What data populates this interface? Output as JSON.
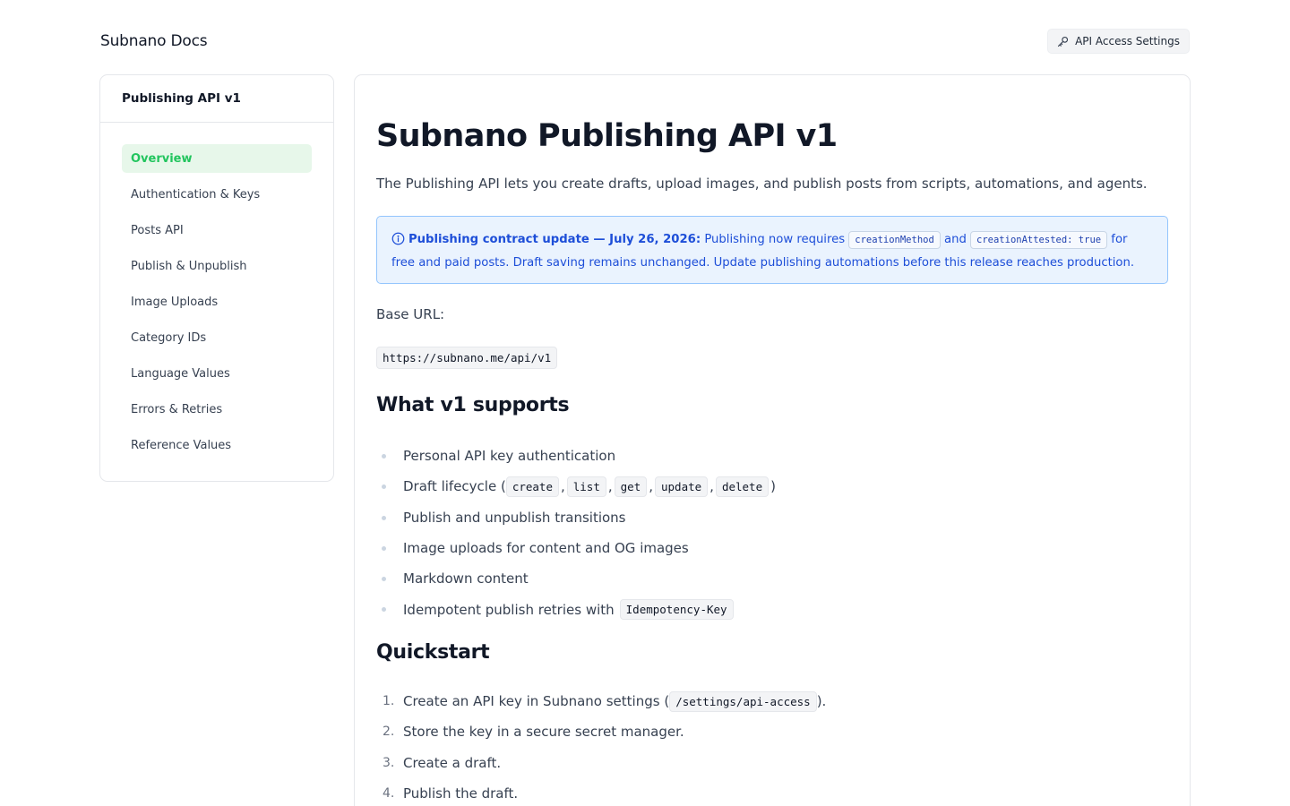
{
  "header": {
    "brand": "Subnano Docs",
    "api_button_label": "API Access Settings",
    "api_button_icon": "key-icon"
  },
  "sidebar": {
    "title": "Publishing API v1",
    "items": [
      {
        "label": "Overview",
        "active": true
      },
      {
        "label": "Authentication & Keys"
      },
      {
        "label": "Posts API"
      },
      {
        "label": "Publish & Unpublish"
      },
      {
        "label": "Image Uploads"
      },
      {
        "label": "Category IDs"
      },
      {
        "label": "Language Values"
      },
      {
        "label": "Errors & Retries"
      },
      {
        "label": "Reference Values"
      }
    ],
    "active_color": "#22c55e"
  },
  "main": {
    "title": "Subnano Publishing API v1",
    "intro": "The Publishing API lets you create drafts, upload images, and publish posts from scripts, automations, and agents.",
    "callout": {
      "icon": "info-icon",
      "heading": "Publishing contract update — July 26, 2026:",
      "text_1": "Publishing now requires",
      "code_1": "creationMethod",
      "and": "and",
      "code_2": "creationAttested: true",
      "text_2": "for free and paid posts. Draft saving remains unchanged. Update publishing automations before this release reaches production.",
      "accent": "#1d4ed8"
    },
    "base_url_label": "Base URL:",
    "base_url": "https://subnano.me/api/v1",
    "supports_heading": "What v1 supports",
    "supports": {
      "item_1": "Personal API key authentication",
      "item_2_prefix": "Draft lifecycle (",
      "item_2_codes": [
        "create",
        "list",
        "get",
        "update",
        "delete"
      ],
      "item_2_suffix": ")",
      "item_3": "Publish and unpublish transitions",
      "item_4": "Image uploads for content and OG images",
      "item_5": "Markdown content",
      "item_6_prefix": "Idempotent publish retries with",
      "item_6_code": "Idempotency-Key"
    },
    "quickstart_heading": "Quickstart",
    "quickstart": {
      "step_1_prefix": "Create an API key in Subnano settings (",
      "step_1_code": "/settings/api-access",
      "step_1_suffix": ").",
      "step_2": "Store the key in a secure secret manager.",
      "step_3": "Create a draft.",
      "step_4": "Publish the draft.",
      "numbers": [
        "1.",
        "2.",
        "3.",
        "4."
      ]
    }
  }
}
